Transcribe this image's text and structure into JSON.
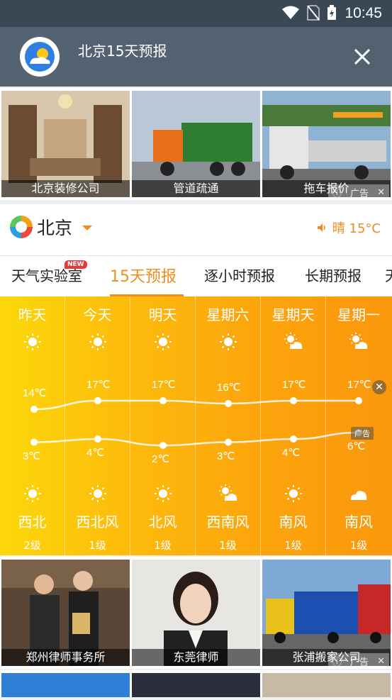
{
  "status_bar": {
    "time": "10:45"
  },
  "header": {
    "title": "北京15天预报"
  },
  "ad_row_top": {
    "items": [
      {
        "caption": "北京装修公司"
      },
      {
        "caption": "管道疏通"
      },
      {
        "caption": "拖车报价"
      }
    ],
    "ad_label": "广告"
  },
  "city": {
    "name": "北京",
    "weather": "晴 15°C"
  },
  "tabs": [
    {
      "label": "天气实验室",
      "badge": "NEW"
    },
    {
      "label": "15天预报"
    },
    {
      "label": "逐小时预报"
    },
    {
      "label": "长期预报"
    },
    {
      "label": "天"
    }
  ],
  "forecast": {
    "days": [
      {
        "day": "昨天",
        "high": "14℃",
        "low": "3℃",
        "wind": "西北",
        "level": "2级",
        "day_icon": "sun-icon",
        "night_icon": "sun-icon"
      },
      {
        "day": "今天",
        "high": "17℃",
        "low": "4℃",
        "wind": "西北风",
        "level": "1级",
        "day_icon": "sun-icon",
        "night_icon": "sun-icon"
      },
      {
        "day": "明天",
        "high": "17℃",
        "low": "2℃",
        "wind": "北风",
        "level": "1级",
        "day_icon": "sun-icon",
        "night_icon": "sun-icon"
      },
      {
        "day": "星期六",
        "high": "16℃",
        "low": "3℃",
        "wind": "西南风",
        "level": "1级",
        "day_icon": "sun-icon",
        "night_icon": "partly-cloudy-icon"
      },
      {
        "day": "星期天",
        "high": "17℃",
        "low": "4℃",
        "wind": "南风",
        "level": "1级",
        "day_icon": "partly-cloudy-icon",
        "night_icon": "sun-icon"
      },
      {
        "day": "星期一",
        "high": "17℃",
        "low": "6℃",
        "wind": "南风",
        "level": "1级",
        "day_icon": "partly-cloudy-icon",
        "night_icon": "cloud-icon"
      }
    ],
    "ad_tag": "广告"
  },
  "ad_row_bottom": {
    "items": [
      {
        "caption": "郑州律师事务所"
      },
      {
        "caption": "东莞律师"
      },
      {
        "caption": "张浦搬家公司"
      }
    ],
    "ad_label": "广告"
  },
  "colors": {
    "accent": "#f08c1e",
    "topbar": "#536270",
    "statusbar": "#3a4856"
  }
}
